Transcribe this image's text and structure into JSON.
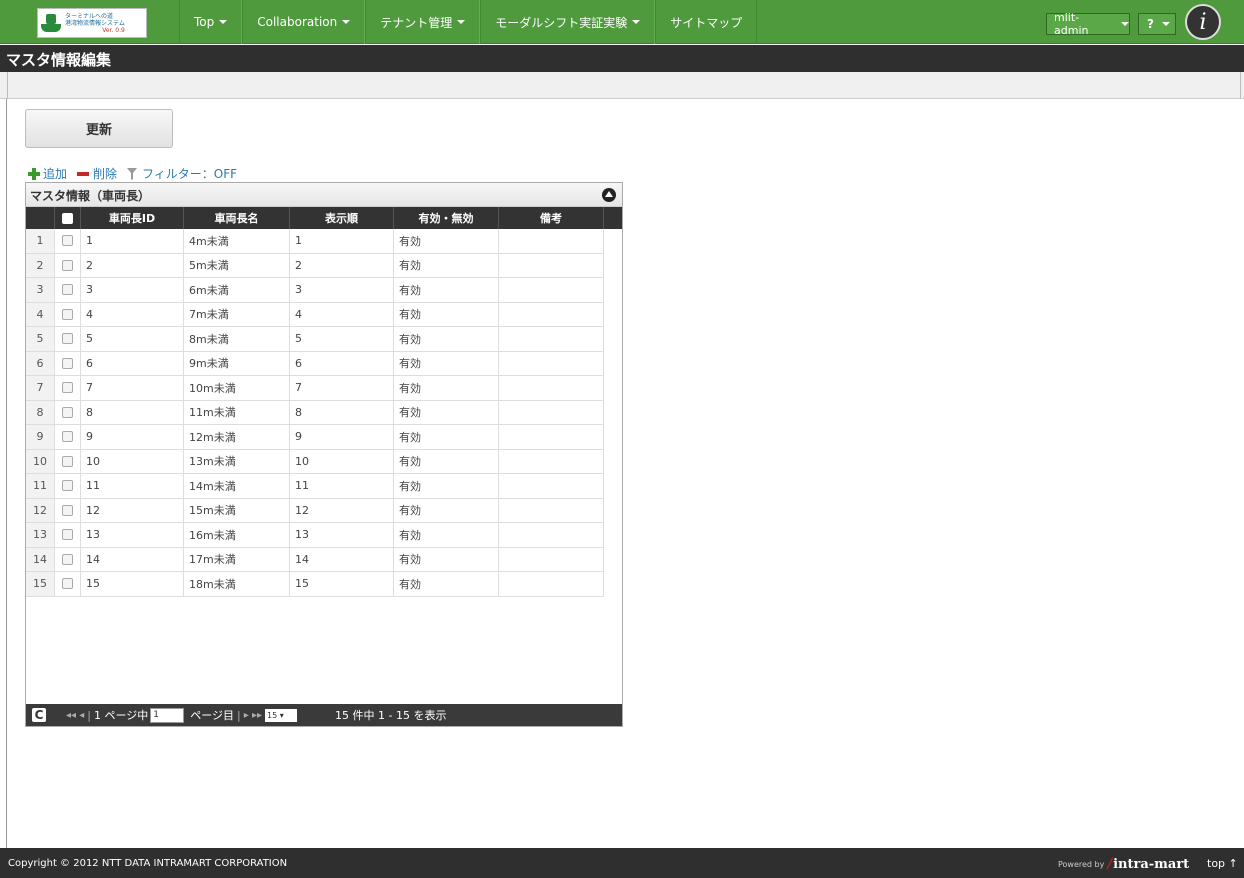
{
  "nav": {
    "logo": {
      "line1": "ターミナルへの道",
      "line2": "港湾物流情報システム",
      "line3": "Ver. 0.9"
    },
    "items": [
      {
        "label": "Top",
        "has_menu": true
      },
      {
        "label": "Collaboration",
        "has_menu": true
      },
      {
        "label": "テナント管理",
        "has_menu": true
      },
      {
        "label": "モーダルシフト実証実験",
        "has_menu": true
      },
      {
        "label": "サイトマップ",
        "has_menu": false
      }
    ],
    "user": "mlit-admin",
    "help": "?",
    "brand_icon": "i"
  },
  "page": {
    "title": "マスタ情報編集"
  },
  "update_button": "更新",
  "toolbar": {
    "add": "追加",
    "delete": "削除",
    "filter": "フィルター：OFF"
  },
  "grid": {
    "caption": "マスタ情報（車両長）",
    "columns": [
      "車両長ID",
      "車両長名",
      "表示順",
      "有効・無効",
      "備考"
    ],
    "rows": [
      {
        "rn": "1",
        "id": "1",
        "name": "4m未満",
        "order": "1",
        "valid": "有効",
        "note": ""
      },
      {
        "rn": "2",
        "id": "2",
        "name": "5m未満",
        "order": "2",
        "valid": "有効",
        "note": ""
      },
      {
        "rn": "3",
        "id": "3",
        "name": "6m未満",
        "order": "3",
        "valid": "有効",
        "note": ""
      },
      {
        "rn": "4",
        "id": "4",
        "name": "7m未満",
        "order": "4",
        "valid": "有効",
        "note": ""
      },
      {
        "rn": "5",
        "id": "5",
        "name": "8m未満",
        "order": "5",
        "valid": "有効",
        "note": ""
      },
      {
        "rn": "6",
        "id": "6",
        "name": "9m未満",
        "order": "6",
        "valid": "有効",
        "note": ""
      },
      {
        "rn": "7",
        "id": "7",
        "name": "10m未満",
        "order": "7",
        "valid": "有効",
        "note": ""
      },
      {
        "rn": "8",
        "id": "8",
        "name": "11m未満",
        "order": "8",
        "valid": "有効",
        "note": ""
      },
      {
        "rn": "9",
        "id": "9",
        "name": "12m未満",
        "order": "9",
        "valid": "有効",
        "note": ""
      },
      {
        "rn": "10",
        "id": "10",
        "name": "13m未満",
        "order": "10",
        "valid": "有効",
        "note": ""
      },
      {
        "rn": "11",
        "id": "11",
        "name": "14m未満",
        "order": "11",
        "valid": "有効",
        "note": ""
      },
      {
        "rn": "12",
        "id": "12",
        "name": "15m未満",
        "order": "12",
        "valid": "有効",
        "note": ""
      },
      {
        "rn": "13",
        "id": "13",
        "name": "16m未満",
        "order": "13",
        "valid": "有効",
        "note": ""
      },
      {
        "rn": "14",
        "id": "14",
        "name": "17m未満",
        "order": "14",
        "valid": "有効",
        "note": ""
      },
      {
        "rn": "15",
        "id": "15",
        "name": "18m未満",
        "order": "15",
        "valid": "有効",
        "note": ""
      }
    ],
    "pager": {
      "first_prev": "◂◂ ◂",
      "page_prefix": "1 ページ中",
      "page_value": "1",
      "page_suffix": "ページ目",
      "next_last": "▸ ▸▸",
      "rows_per_page": "15 ▾",
      "records": "15 件中 1 - 15 を表示"
    }
  },
  "footer": {
    "copyright": "Copyright © 2012 NTT DATA INTRAMART CORPORATION",
    "powered_by": "Powered by",
    "brand": "intra-mart",
    "top_link": "top ↑"
  },
  "colors": {
    "nav_green": "#4e9a3c",
    "dark_bar": "#2f2f2f",
    "link_blue": "#2a7ab0"
  }
}
